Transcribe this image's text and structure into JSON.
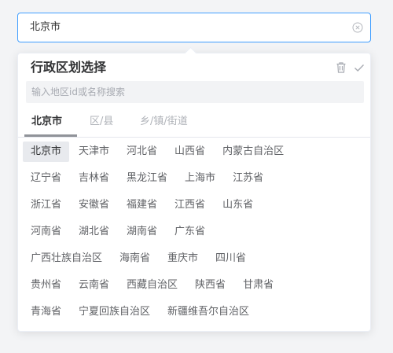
{
  "picker": {
    "value": "北京市"
  },
  "panel": {
    "title": "行政区划选择",
    "search_placeholder": "输入地区id或名称搜索",
    "tabs": [
      {
        "label": "北京市",
        "active": true
      },
      {
        "label": "区/县",
        "active": false
      },
      {
        "label": "乡/镇/街道",
        "active": false
      }
    ],
    "selected_region": "北京市",
    "regions": [
      [
        "北京市",
        "天津市",
        "河北省",
        "山西省",
        "内蒙古自治区"
      ],
      [
        "辽宁省",
        "吉林省",
        "黑龙江省",
        "上海市",
        "江苏省"
      ],
      [
        "浙江省",
        "安徽省",
        "福建省",
        "江西省",
        "山东省"
      ],
      [
        "河南省",
        "湖北省",
        "湖南省",
        "广东省"
      ],
      [
        "广西壮族自治区",
        "海南省",
        "重庆市",
        "四川省"
      ],
      [
        "贵州省",
        "云南省",
        "西藏自治区",
        "陕西省",
        "甘肃省"
      ],
      [
        "青海省",
        "宁夏回族自治区",
        "新疆维吾尔自治区"
      ]
    ]
  },
  "icons": {
    "clear": "circle-x-icon",
    "delete": "trash-icon",
    "confirm": "check-icon"
  },
  "colors": {
    "accent_border": "#409eff",
    "selected_bg": "#e8eaee",
    "tab_underline": "#909399"
  }
}
